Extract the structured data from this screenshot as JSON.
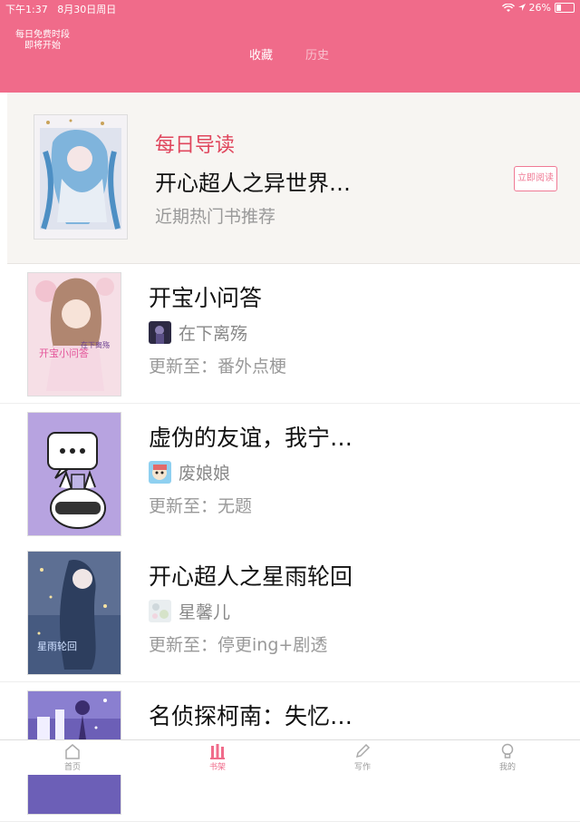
{
  "status": {
    "time": "下午1:37",
    "date": "8月30日周日",
    "battery": "26%",
    "battery_level": 0.26
  },
  "header": {
    "free_period": "每日免费时段",
    "free_start": "即将开始",
    "tabs": [
      "收藏",
      "历史"
    ]
  },
  "featured": {
    "label": "每日导读",
    "title": "开心超人之异世界…",
    "subtitle": "近期热门书推荐",
    "button": "立即阅读"
  },
  "books": [
    {
      "title": "开宝小问答",
      "author": "在下离殇",
      "update_prefix": "更新至：",
      "update": "番外点梗"
    },
    {
      "title": "虚伪的友谊，我宁…",
      "author": "废娘娘",
      "update_prefix": "更新至：",
      "update": "无题"
    },
    {
      "title": "开心超人之星雨轮回",
      "author": "星馨儿",
      "update_prefix": "更新至：",
      "update": "停更ing+剧透"
    },
    {
      "title": "名侦探柯南：失忆…"
    }
  ],
  "covers": {
    "book0_text": "开宝小问答",
    "book0_tag": "在下离殇",
    "book2_text": "星雨轮回"
  },
  "nav": [
    "首页",
    "书架",
    "写作",
    "我的"
  ],
  "colors": {
    "brand": "#f06b8a",
    "accent": "#e0465d"
  }
}
